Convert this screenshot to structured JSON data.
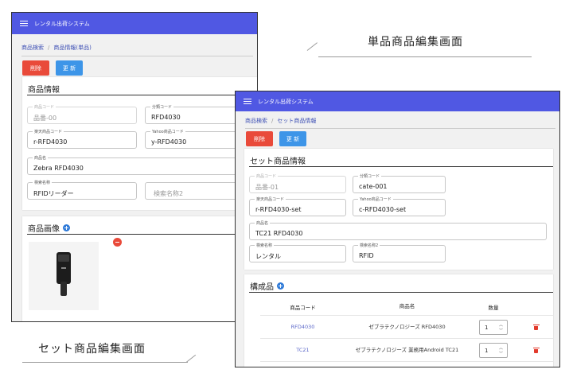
{
  "captions": {
    "single": "単品商品編集画面",
    "set": "セット商品編集画面"
  },
  "single_window": {
    "app_title": "レンタル出荷システム",
    "breadcrumb": [
      "商品検索",
      "商品情報(単品)"
    ],
    "delete_label": "削除",
    "update_label": "更 新",
    "info_title": "商品情報",
    "fields": {
      "product_code": {
        "label": "商品コード",
        "value": "品番-00"
      },
      "category_code": {
        "label": "分類コード",
        "value": "RFD4030"
      },
      "rakuten_code": {
        "label": "楽天商品コード",
        "value": "r-RFD4030"
      },
      "yahoo_code": {
        "label": "Yahoo商品コード",
        "value": "y-RFD4030"
      },
      "product_name": {
        "label": "商品名",
        "value": "Zebra RFD4030"
      },
      "search_name": {
        "label": "検索名称",
        "value": "RFIDリーダー"
      },
      "search_name2": {
        "placeholder": "検索名称2"
      }
    },
    "image_title": "商品画像"
  },
  "set_window": {
    "app_title": "レンタル出荷システム",
    "breadcrumb": [
      "商品検索",
      "セット商品情報"
    ],
    "delete_label": "削除",
    "update_label": "更 新",
    "info_title": "セット商品情報",
    "fields": {
      "product_code": {
        "label": "商品コード",
        "value": "品番-01"
      },
      "category_code": {
        "label": "分類コード",
        "value": "cate-001"
      },
      "rakuten_code": {
        "label": "楽天商品コード",
        "value": "r-RFD4030-set"
      },
      "yahoo_code": {
        "label": "Yahoo商品コード",
        "value": "c-RFD4030-set"
      },
      "product_name": {
        "label": "商品名",
        "value": "TC21 RFD4030"
      },
      "search_name": {
        "label": "検索名称",
        "value": "レンタル"
      },
      "search_name2": {
        "label": "検索名称2",
        "value": "RFID"
      }
    },
    "components_title": "構成品",
    "table": {
      "headers": [
        "商品コード",
        "商品名",
        "数量"
      ],
      "rows": [
        {
          "code": "RFD4030",
          "name": "ゼブラテクノロジーズ RFD4030",
          "qty": "1"
        },
        {
          "code": "TC21",
          "name": "ゼブラテクノロジーズ 業務用Android TC21",
          "qty": "1"
        }
      ]
    }
  }
}
